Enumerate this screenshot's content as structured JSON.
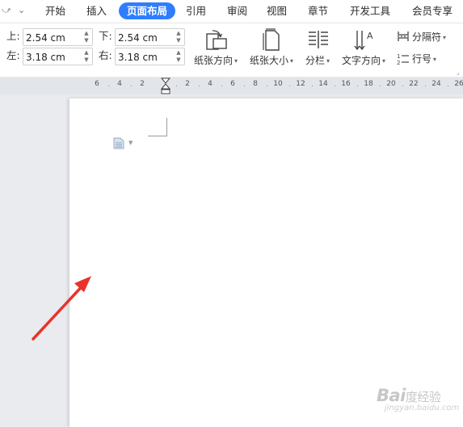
{
  "quick_access": {
    "redo_icon": "redo-icon",
    "dropdown_icon": "chevron-down-icon"
  },
  "tabs": [
    {
      "label": "开始"
    },
    {
      "label": "插入"
    },
    {
      "label": "页面布局",
      "active": true
    },
    {
      "label": "引用"
    },
    {
      "label": "审阅"
    },
    {
      "label": "视图"
    },
    {
      "label": "章节"
    },
    {
      "label": "开发工具"
    },
    {
      "label": "会员专享"
    }
  ],
  "margins": {
    "top_label": "上:",
    "top_value": "2.54 cm",
    "bottom_label": "下:",
    "bottom_value": "2.54 cm",
    "left_label": "左:",
    "left_value": "3.18 cm",
    "right_label": "右:",
    "right_value": "3.18 cm"
  },
  "toolbar": {
    "orientation_label": "纸张方向",
    "size_label": "纸张大小",
    "columns_label": "分栏",
    "text_direction_label": "文字方向",
    "breaks_label": "分隔符",
    "line_numbers_label": "行号"
  },
  "ruler": {
    "left_ticks": [
      "6",
      "4",
      "2"
    ],
    "right_ticks": [
      "2",
      "4",
      "6",
      "8",
      "10",
      "12",
      "14",
      "16",
      "18",
      "20",
      "22",
      "24",
      "26"
    ]
  },
  "annotation": {
    "arrow_color": "#e8342b"
  },
  "watermark": {
    "main_latin_1": "Bai",
    "main_cn_1": "度",
    "main_cn_2": "经验",
    "sub": "jingyan.baidu.com"
  },
  "colors": {
    "accent": "#2f7dff"
  }
}
